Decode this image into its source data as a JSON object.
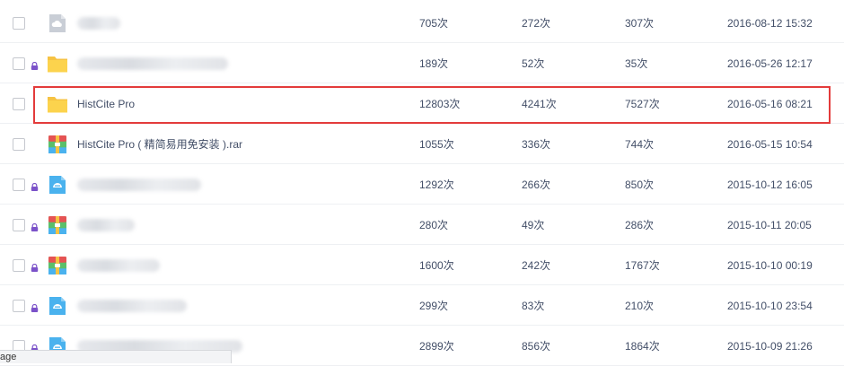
{
  "file_list": {
    "rows": [
      {
        "name": "",
        "name_hidden": true,
        "icon": "cloud-file-icon",
        "locked": false,
        "downloads": "705次",
        "saves": "272次",
        "views": "307次",
        "time": "2016-08-12 15:32"
      },
      {
        "name": "",
        "name_hidden": true,
        "icon": "folder-icon",
        "locked": true,
        "downloads": "189次",
        "saves": "52次",
        "views": "35次",
        "time": "2016-05-26 12:17"
      },
      {
        "name": "HistCite Pro",
        "name_hidden": false,
        "icon": "folder-icon",
        "locked": false,
        "highlighted": true,
        "downloads": "12803次",
        "saves": "4241次",
        "views": "7527次",
        "time": "2016-05-16 08:21"
      },
      {
        "name": "HistCite Pro ( 精简易用免安装 ).rar",
        "name_hidden": false,
        "icon": "archive-icon",
        "locked": false,
        "downloads": "1055次",
        "saves": "336次",
        "views": "744次",
        "time": "2016-05-15 10:54"
      },
      {
        "name": "",
        "name_hidden": true,
        "icon": "app-file-icon",
        "locked": true,
        "downloads": "1292次",
        "saves": "266次",
        "views": "850次",
        "time": "2015-10-12 16:05"
      },
      {
        "name": "",
        "name_hidden": true,
        "icon": "archive-icon",
        "locked": true,
        "downloads": "280次",
        "saves": "49次",
        "views": "286次",
        "time": "2015-10-11 20:05"
      },
      {
        "name": "",
        "name_hidden": true,
        "icon": "archive-icon",
        "locked": true,
        "downloads": "1600次",
        "saves": "242次",
        "views": "1767次",
        "time": "2015-10-10 00:19"
      },
      {
        "name": "",
        "name_hidden": true,
        "icon": "app-file-icon",
        "locked": true,
        "downloads": "299次",
        "saves": "83次",
        "views": "210次",
        "time": "2015-10-10 23:54"
      },
      {
        "name": "",
        "name_hidden": true,
        "icon": "app-file-icon",
        "locked": true,
        "downloads": "2899次",
        "saves": "856次",
        "views": "1864次",
        "time": "2015-10-09 21:26"
      }
    ]
  },
  "status_bar": {
    "text": "age"
  },
  "colors": {
    "text": "#424e67",
    "highlight_border": "#e33b3b",
    "folder": "#fcd34d",
    "lock": "#7b52c9",
    "app_file": "#4ab2ee",
    "archive_red": "#e55353",
    "archive_green": "#5bbf6a",
    "archive_yellow": "#f6c343",
    "row_divider": "#eef0f3"
  }
}
